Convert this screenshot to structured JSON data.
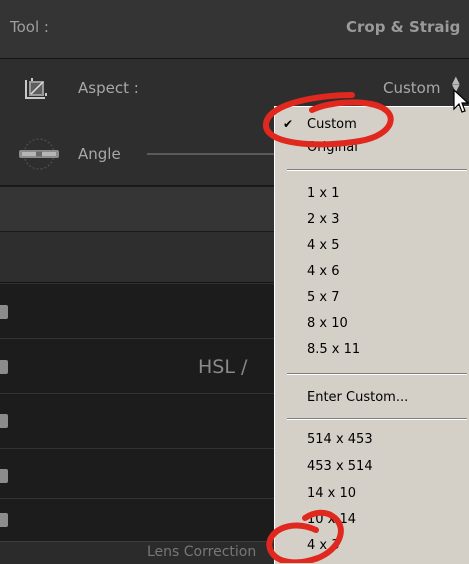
{
  "tool": {
    "label": "Tool :",
    "value": "Crop & Straig"
  },
  "aspect": {
    "label": "Aspect :",
    "value": "Custom"
  },
  "angle": {
    "label": "Angle"
  },
  "panels": {
    "hsl_label": "HSL  /",
    "bottom_label": "Lens Correction"
  },
  "menu": {
    "items": [
      {
        "label": "Custom",
        "checked": true
      },
      {
        "label": "Original"
      },
      {
        "label": "1 x 1"
      },
      {
        "label": "2 x 3"
      },
      {
        "label": "4 x 5"
      },
      {
        "label": "4 x 6"
      },
      {
        "label": "5 x 7"
      },
      {
        "label": "8 x 10"
      },
      {
        "label": "8.5 x 11"
      },
      {
        "label": "Enter Custom..."
      },
      {
        "label": "514 x 453"
      },
      {
        "label": "453 x 514"
      },
      {
        "label": "14 x 10"
      },
      {
        "label": "10 x 14"
      },
      {
        "label": "4 x 3"
      }
    ],
    "check_glyph": "✔"
  },
  "colors": {
    "annotation": "#e0281e",
    "menu_bg": "#d4d0c8",
    "panel_bg": "#2e2e2e"
  }
}
